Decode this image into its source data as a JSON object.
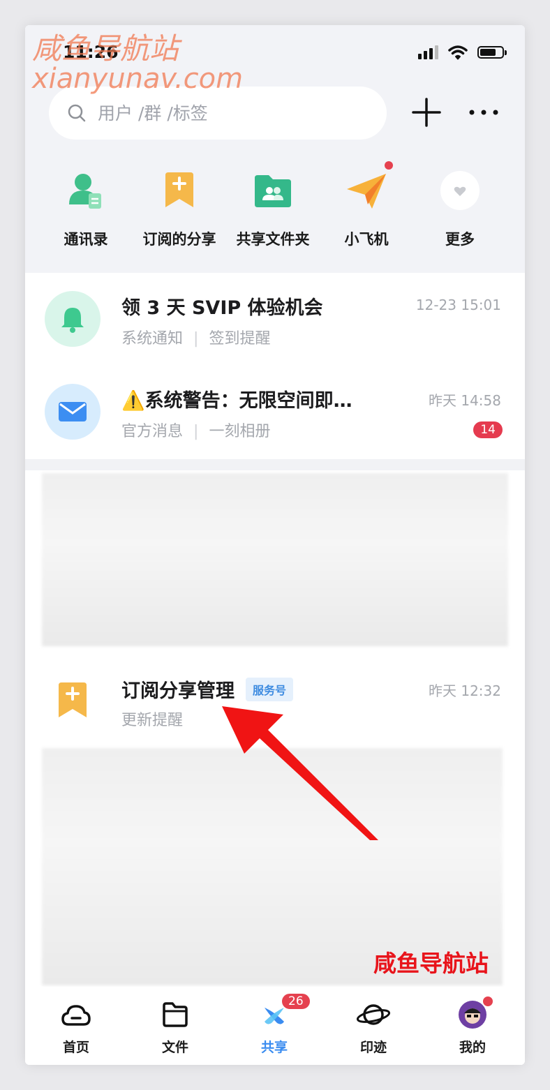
{
  "status_bar": {
    "time": "11:26"
  },
  "watermark": {
    "top_line1": "咸鱼导航站",
    "top_line2": "xianyunav.com",
    "bottom": "咸鱼导航站"
  },
  "search": {
    "placeholder": "用户 /群 /标签"
  },
  "quick_actions": [
    {
      "label": "通讯录",
      "icon": "contacts-icon"
    },
    {
      "label": "订阅的分享",
      "icon": "bookmark-icon"
    },
    {
      "label": "共享文件夹",
      "icon": "shared-folder-icon"
    },
    {
      "label": "小飞机",
      "icon": "paper-plane-icon"
    },
    {
      "label": "更多",
      "icon": "heart-icon"
    }
  ],
  "messages": [
    {
      "title": "领 3 天 SVIP 体验机会",
      "sub_left": "系统通知",
      "sub_right": "签到提醒",
      "time": "12-23 15:01",
      "icon": "bell-icon"
    },
    {
      "title": "⚠️系统警告：无限空间即…",
      "sub_left": "官方消息",
      "sub_right": "一刻相册",
      "time": "昨天 14:58",
      "unread": "14",
      "icon": "mail-icon"
    }
  ],
  "service_item": {
    "title": "订阅分享管理",
    "badge": "服务号",
    "sub": "更新提醒",
    "time": "昨天 12:32",
    "icon": "bookmark-icon"
  },
  "tabbar": [
    {
      "label": "首页",
      "icon": "cloud-icon"
    },
    {
      "label": "文件",
      "icon": "folder-icon"
    },
    {
      "label": "共享",
      "icon": "share-icon",
      "badge": "26",
      "active": true
    },
    {
      "label": "印迹",
      "icon": "planet-icon"
    },
    {
      "label": "我的",
      "icon": "avatar-icon"
    }
  ],
  "colors": {
    "accent": "#3a8cf0",
    "badge_red": "#e5414f",
    "arrow_red": "#f01414"
  }
}
